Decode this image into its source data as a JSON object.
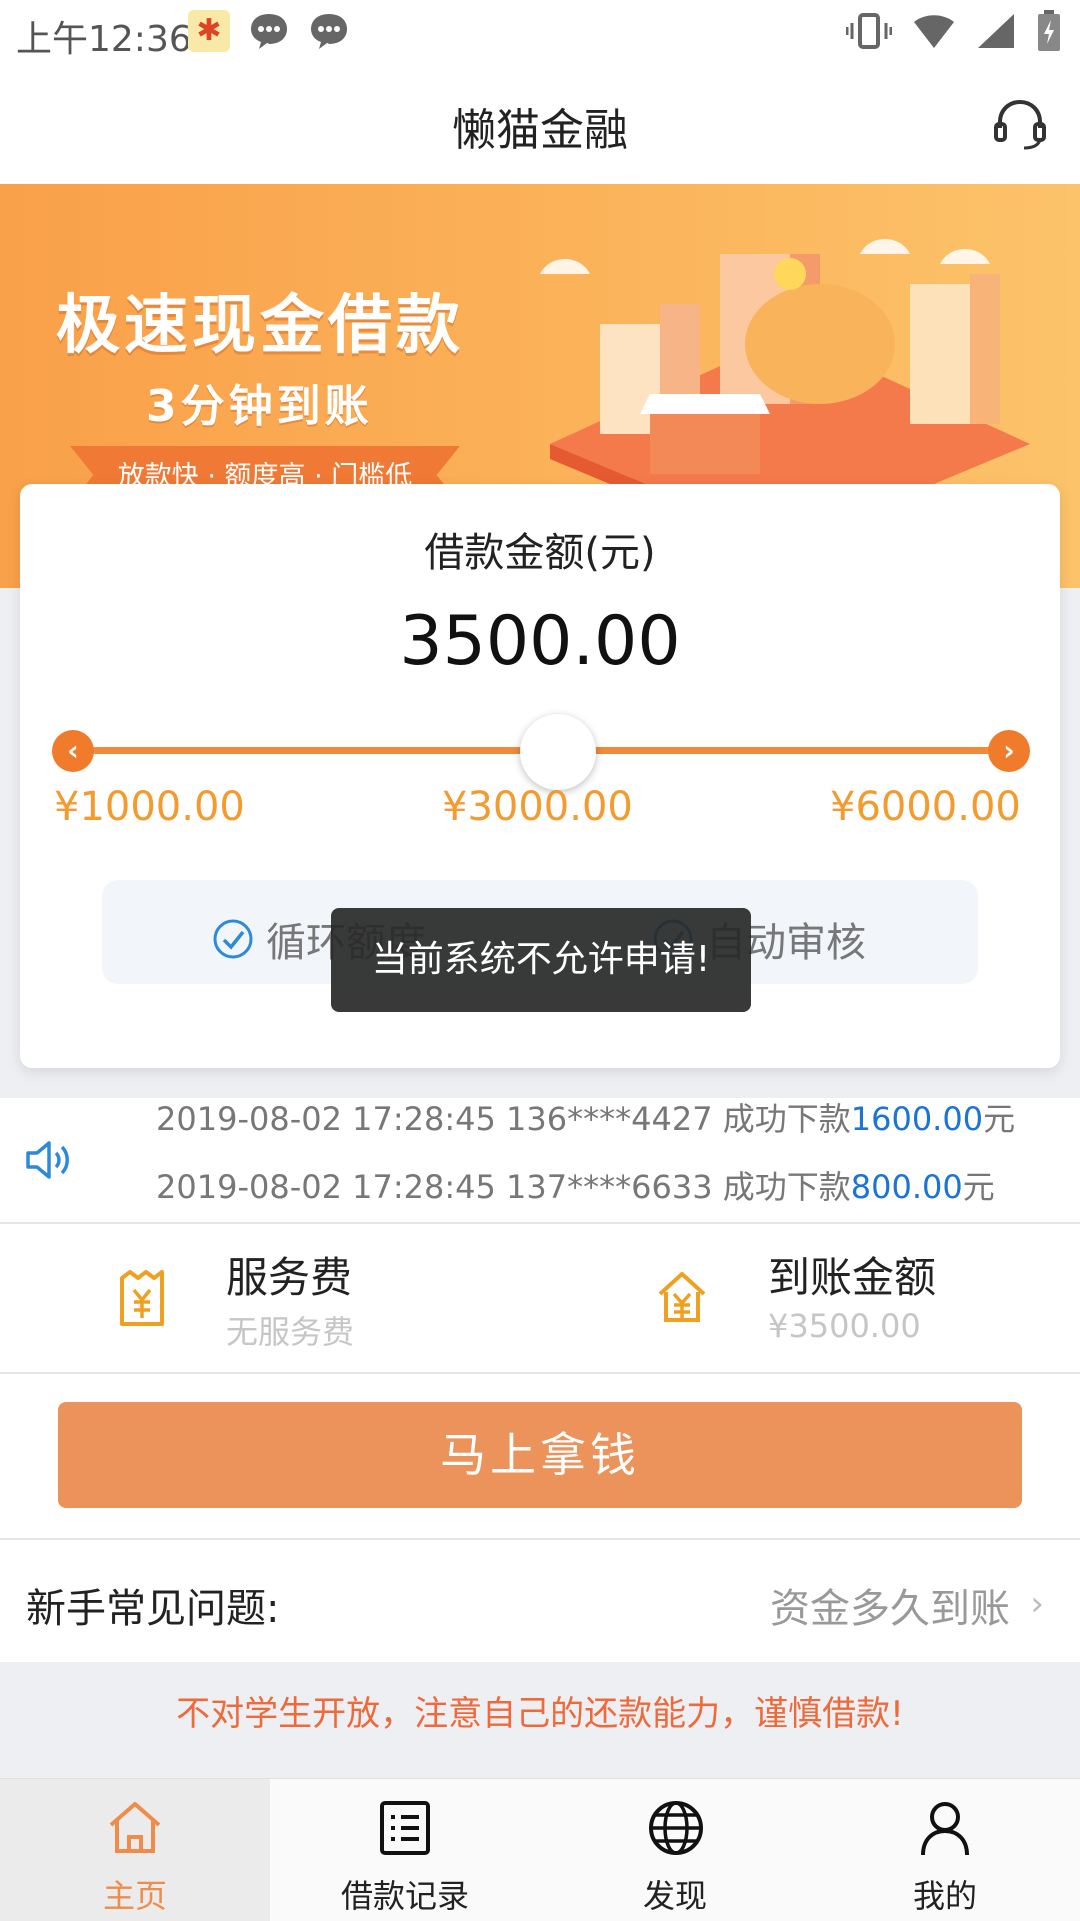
{
  "status_bar": {
    "time": "上午12:36"
  },
  "header": {
    "title": "懒猫金融"
  },
  "banner": {
    "headline": "极速现金借款",
    "subheadline": "3分钟到账",
    "tagline": "放款快 · 额度高 · 门槛低"
  },
  "loan_card": {
    "label": "借款金额(元)",
    "amount": "3500.00",
    "slider": {
      "min_label": "¥1000.00",
      "mid_label": "¥3000.00",
      "max_label": "¥6000.00",
      "value_fraction": 0.5
    },
    "features": [
      "循环额度",
      "自动审核"
    ],
    "toast": "当前系统不允许申请!"
  },
  "ticker": {
    "lines": [
      {
        "prefix": "2019-08-02 17:28:45  136****4427  成功下款",
        "amount": "1600.00",
        "suffix": "元"
      },
      {
        "prefix": "2019-08-02 17:28:45  137****6633  成功下款",
        "amount": "800.00",
        "suffix": "元"
      }
    ]
  },
  "fees": {
    "service_fee_title": "服务费",
    "service_fee_value": "无服务费",
    "arrival_title": "到账金额",
    "arrival_value": "¥3500.00"
  },
  "cta_label": "马上拿钱",
  "faq": {
    "label": "新手常见问题:",
    "link": "资金多久到账",
    "chevron": "›"
  },
  "warning": "不对学生开放，注意自己的还款能力，谨慎借款!",
  "tabs": [
    {
      "label": "主页",
      "icon": "home-icon",
      "active": true
    },
    {
      "label": "借款记录",
      "icon": "list-icon",
      "active": false
    },
    {
      "label": "发现",
      "icon": "globe-icon",
      "active": false
    },
    {
      "label": "我的",
      "icon": "user-icon",
      "active": false
    }
  ],
  "colors": {
    "accent": "#f08c4a",
    "cta": "#ec925b",
    "link_blue": "#1c74d6",
    "warning": "#ef6a3a"
  }
}
